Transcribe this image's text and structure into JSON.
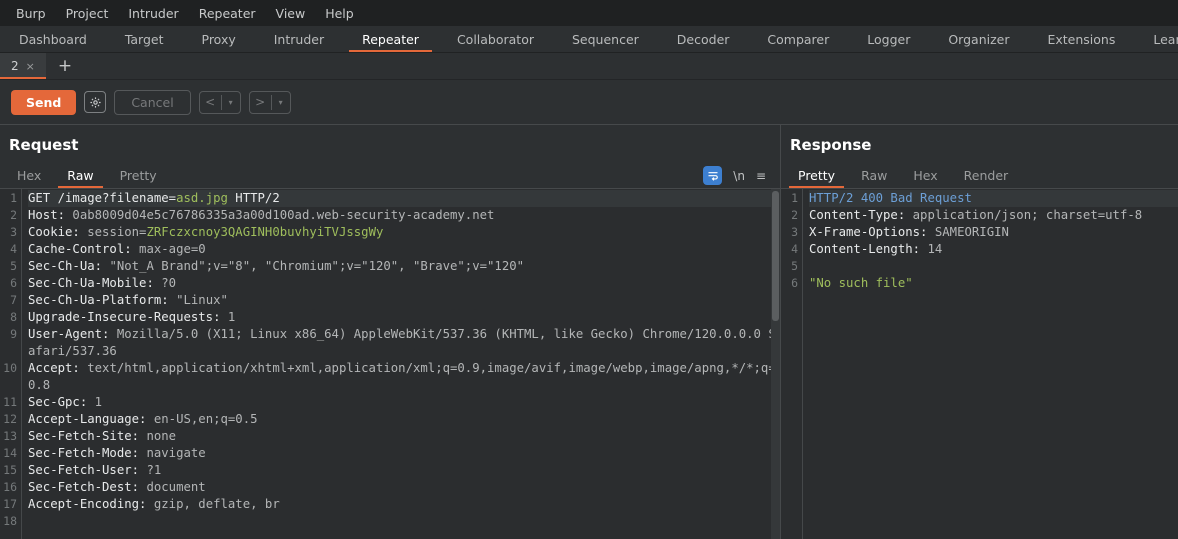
{
  "app": {
    "title": "Burp Suite Repeater"
  },
  "menubar": {
    "items": [
      {
        "label": "Burp"
      },
      {
        "label": "Project"
      },
      {
        "label": "Intruder"
      },
      {
        "label": "Repeater"
      },
      {
        "label": "View"
      },
      {
        "label": "Help"
      }
    ]
  },
  "main_tabs": {
    "active": "Repeater",
    "items": [
      {
        "label": "Dashboard"
      },
      {
        "label": "Target"
      },
      {
        "label": "Proxy"
      },
      {
        "label": "Intruder"
      },
      {
        "label": "Repeater"
      },
      {
        "label": "Collaborator"
      },
      {
        "label": "Sequencer"
      },
      {
        "label": "Decoder"
      },
      {
        "label": "Comparer"
      },
      {
        "label": "Logger"
      },
      {
        "label": "Organizer"
      },
      {
        "label": "Extensions"
      },
      {
        "label": "Learn"
      }
    ]
  },
  "repeater_tabs": {
    "active_tab_label": "2",
    "close_glyph": "×",
    "new_tab_glyph": "+"
  },
  "action_bar": {
    "send_label": "Send",
    "settings_icon": "gear-icon",
    "cancel_label": "Cancel",
    "back_glyph": "<",
    "forward_glyph": ">",
    "dropdown_glyph": "▾"
  },
  "request": {
    "title": "Request",
    "tabs": [
      {
        "label": "Pretty",
        "active": false
      },
      {
        "label": "Raw",
        "active": true
      },
      {
        "label": "Hex",
        "active": false
      }
    ],
    "icons": [
      {
        "name": "word-wrap-icon",
        "active": true
      },
      {
        "name": "newline-icon",
        "glyph": "\\n",
        "active": false
      },
      {
        "name": "menu-icon",
        "glyph": "≡",
        "active": false
      }
    ],
    "lines": [
      {
        "n": 1,
        "segments": [
          {
            "t": "GET /image?filename=",
            "c": "white"
          },
          {
            "t": "asd.jpg",
            "c": "green"
          },
          {
            "t": " HTTP/2",
            "c": "white"
          }
        ]
      },
      {
        "n": 2,
        "segments": [
          {
            "t": "Host:",
            "c": "name"
          },
          {
            "t": " 0ab8009d04e5c76786335a3a00d100ad.web-security-academy.net",
            "c": "val"
          }
        ]
      },
      {
        "n": 3,
        "segments": [
          {
            "t": "Cookie:",
            "c": "name"
          },
          {
            "t": " session=",
            "c": "val"
          },
          {
            "t": "ZRFczxcnoy3QAGINH0buvhyiTVJssgWy",
            "c": "green"
          }
        ]
      },
      {
        "n": 4,
        "segments": [
          {
            "t": "Cache-Control:",
            "c": "name"
          },
          {
            "t": " max-age=0",
            "c": "val"
          }
        ]
      },
      {
        "n": 5,
        "segments": [
          {
            "t": "Sec-Ch-Ua:",
            "c": "name"
          },
          {
            "t": " \"Not_A Brand\";v=\"8\", \"Chromium\";v=\"120\", \"Brave\";v=\"120\"",
            "c": "val"
          }
        ]
      },
      {
        "n": 6,
        "segments": [
          {
            "t": "Sec-Ch-Ua-Mobile:",
            "c": "name"
          },
          {
            "t": " ?0",
            "c": "val"
          }
        ]
      },
      {
        "n": 7,
        "segments": [
          {
            "t": "Sec-Ch-Ua-Platform:",
            "c": "name"
          },
          {
            "t": " \"Linux\"",
            "c": "val"
          }
        ]
      },
      {
        "n": 8,
        "segments": [
          {
            "t": "Upgrade-Insecure-Requests:",
            "c": "name"
          },
          {
            "t": " 1",
            "c": "val"
          }
        ]
      },
      {
        "n": 9,
        "segments": [
          {
            "t": "User-Agent:",
            "c": "name"
          },
          {
            "t": " Mozilla/5.0 (X11; Linux x86_64) AppleWebKit/537.36 (KHTML, like Gecko) Chrome/120.0.0.0 Safari/537.36",
            "c": "val"
          }
        ]
      },
      {
        "n": 10,
        "segments": [
          {
            "t": "Accept:",
            "c": "name"
          },
          {
            "t": " text/html,application/xhtml+xml,application/xml;q=0.9,image/avif,image/webp,image/apng,*/*;q=0.8",
            "c": "val"
          }
        ]
      },
      {
        "n": 11,
        "segments": [
          {
            "t": "Sec-Gpc:",
            "c": "name"
          },
          {
            "t": " 1",
            "c": "val"
          }
        ]
      },
      {
        "n": 12,
        "segments": [
          {
            "t": "Accept-Language:",
            "c": "name"
          },
          {
            "t": " en-US,en;q=0.5",
            "c": "val"
          }
        ]
      },
      {
        "n": 13,
        "segments": [
          {
            "t": "Sec-Fetch-Site:",
            "c": "name"
          },
          {
            "t": " none",
            "c": "val"
          }
        ]
      },
      {
        "n": 14,
        "segments": [
          {
            "t": "Sec-Fetch-Mode:",
            "c": "name"
          },
          {
            "t": " navigate",
            "c": "val"
          }
        ]
      },
      {
        "n": 15,
        "segments": [
          {
            "t": "Sec-Fetch-User:",
            "c": "name"
          },
          {
            "t": " ?1",
            "c": "val"
          }
        ]
      },
      {
        "n": 16,
        "segments": [
          {
            "t": "Sec-Fetch-Dest:",
            "c": "name"
          },
          {
            "t": " document",
            "c": "val"
          }
        ]
      },
      {
        "n": 17,
        "segments": [
          {
            "t": "Accept-Encoding:",
            "c": "name"
          },
          {
            "t": " gzip, deflate, br",
            "c": "val"
          }
        ]
      },
      {
        "n": 18,
        "segments": []
      }
    ]
  },
  "response": {
    "title": "Response",
    "tabs": [
      {
        "label": "Pretty",
        "active": true
      },
      {
        "label": "Raw",
        "active": false
      },
      {
        "label": "Hex",
        "active": false
      },
      {
        "label": "Render",
        "active": false
      }
    ],
    "lines": [
      {
        "n": 1,
        "segments": [
          {
            "t": "HTTP/2 400 Bad Request",
            "c": "blue"
          }
        ]
      },
      {
        "n": 2,
        "segments": [
          {
            "t": "Content-Type:",
            "c": "name"
          },
          {
            "t": " application/json; charset=utf-8",
            "c": "val"
          }
        ]
      },
      {
        "n": 3,
        "segments": [
          {
            "t": "X-Frame-Options:",
            "c": "name"
          },
          {
            "t": " SAMEORIGIN",
            "c": "val"
          }
        ]
      },
      {
        "n": 4,
        "segments": [
          {
            "t": "Content-Length:",
            "c": "name"
          },
          {
            "t": " 14",
            "c": "val"
          }
        ]
      },
      {
        "n": 5,
        "segments": []
      },
      {
        "n": 6,
        "segments": [
          {
            "t": "\"No such file\"",
            "c": "green"
          }
        ]
      }
    ]
  },
  "colors": {
    "accent_orange": "#e4683a",
    "window_bg": "#2d3032",
    "menubar_bg": "#1f2122",
    "editor_bg": "#2b2d2f",
    "string_green": "#9fbe5c",
    "status_blue": "#6c9fd6",
    "icon_active_blue": "#3d7fd0"
  }
}
